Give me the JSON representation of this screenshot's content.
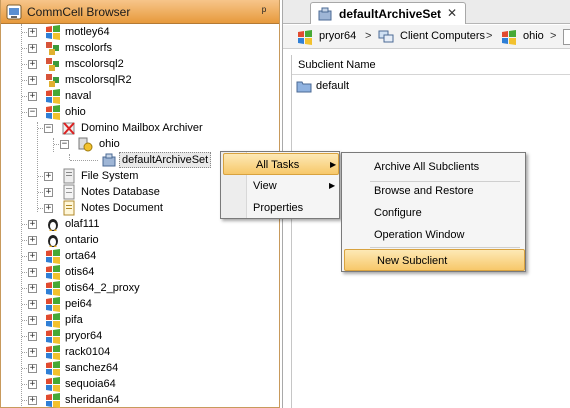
{
  "left_panel": {
    "title": "CommCell Browser",
    "pin_icon": "pin-icon"
  },
  "tree": {
    "clients_top": [
      {
        "label": "motley64",
        "icon": "windows-icon"
      },
      {
        "label": "mscolorfs",
        "icon": "cluster-icon"
      },
      {
        "label": "mscolorsql2",
        "icon": "cluster-icon"
      },
      {
        "label": "mscolorsqlR2",
        "icon": "cluster-icon"
      },
      {
        "label": "naval",
        "icon": "windows-icon"
      },
      {
        "label": "ohio",
        "icon": "windows-icon"
      }
    ],
    "ohio_children": {
      "agent": "Domino Mailbox Archiver",
      "instance": "ohio",
      "backupset": "defaultArchiveSet",
      "file_system": "File System",
      "notes_database": "Notes Database",
      "notes_document": "Notes Document"
    },
    "clients_bottom": [
      {
        "label": "olaf111",
        "icon": "linux-icon"
      },
      {
        "label": "ontario",
        "icon": "linux-icon"
      },
      {
        "label": "orta64",
        "icon": "windows-icon"
      },
      {
        "label": "otis64",
        "icon": "windows-icon"
      },
      {
        "label": "otis64_2_proxy",
        "icon": "windows-icon"
      },
      {
        "label": "pei64",
        "icon": "windows-icon"
      },
      {
        "label": "pifa",
        "icon": "windows-icon"
      },
      {
        "label": "pryor64",
        "icon": "windows-icon"
      },
      {
        "label": "rack0104",
        "icon": "windows-icon"
      },
      {
        "label": "sanchez64",
        "icon": "windows-icon"
      },
      {
        "label": "sequoia64",
        "icon": "windows-icon"
      },
      {
        "label": "sheridan64",
        "icon": "windows-icon"
      }
    ]
  },
  "right_panel": {
    "tab_label": "defaultArchiveSet",
    "tab_close": "✕",
    "breadcrumb": [
      "pryor64",
      "Client Computers",
      "ohio"
    ],
    "breadcrumb_sep": ">",
    "column_header": "Subclient Name",
    "rows": [
      "default"
    ]
  },
  "context_menu": {
    "items": [
      "All Tasks",
      "View",
      "Properties"
    ]
  },
  "submenu": {
    "items": [
      "Archive All Subclients",
      "Browse and Restore",
      "Configure",
      "Operation Window",
      "New Subclient"
    ]
  },
  "colors": {
    "header_orange": "#e79a3c",
    "highlight": "#f7c86a",
    "windows_blue": "#2f7fd6"
  }
}
